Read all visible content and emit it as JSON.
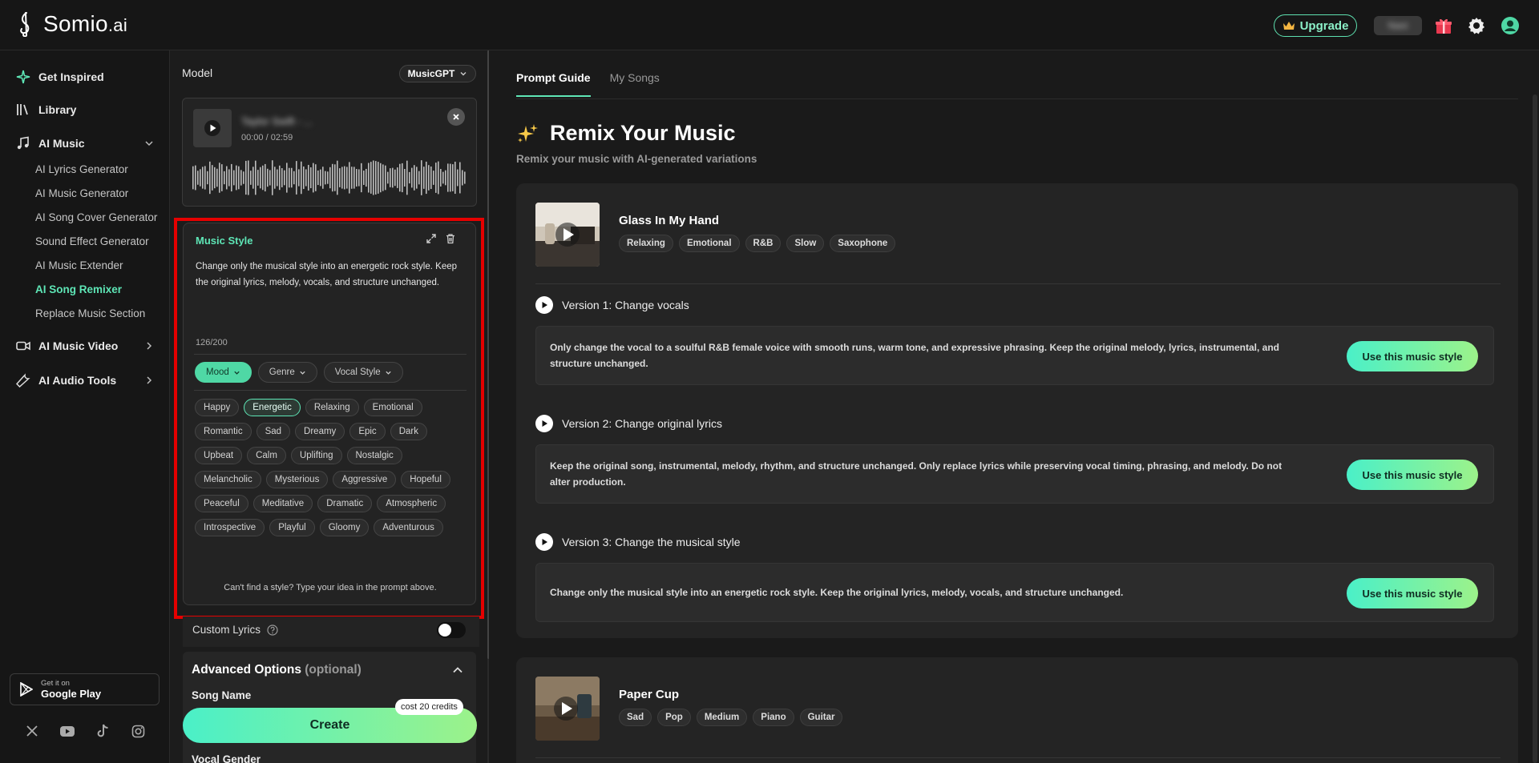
{
  "app": {
    "logo_main": "Somio",
    "logo_suffix": ".ai",
    "upgrade_label": "Upgrade",
    "user_label": "Nani"
  },
  "sidebar": {
    "get_inspired": "Get Inspired",
    "library": "Library",
    "ai_music": "AI Music",
    "sub_items": [
      "AI Lyrics Generator",
      "AI Music Generator",
      "AI Song Cover Generator",
      "Sound Effect Generator",
      "AI Music Extender",
      "AI Song Remixer",
      "Replace Music Section"
    ],
    "active_sub_index": 5,
    "ai_music_video": "AI Music Video",
    "ai_audio_tools": "AI Audio Tools",
    "gplay_small": "Get it on",
    "gplay_big": "Google Play"
  },
  "panel": {
    "model_label": "Model",
    "model_value": "MusicGPT",
    "player": {
      "title": "Taylor Swift - ...",
      "time": "00:00 / 02:59"
    },
    "style": {
      "title": "Music Style",
      "text": "Change only the musical style into an energetic rock style. Keep the original lyrics, melody, vocals, and structure unchanged.",
      "counter": "126/200",
      "filters": [
        "Mood",
        "Genre",
        "Vocal Style"
      ],
      "active_filter": "Mood",
      "chips": [
        "Happy",
        "Energetic",
        "Relaxing",
        "Emotional",
        "Romantic",
        "Sad",
        "Dreamy",
        "Epic",
        "Dark",
        "Upbeat",
        "Calm",
        "Uplifting",
        "Nostalgic",
        "Melancholic",
        "Mysterious",
        "Aggressive",
        "Hopeful",
        "Peaceful",
        "Meditative",
        "Dramatic",
        "Atmospheric",
        "Introspective",
        "Playful",
        "Gloomy",
        "Adventurous"
      ],
      "active_chip": "Energetic",
      "footer": "Can't find a style? Type your idea in the prompt above."
    },
    "custom_lyrics": "Custom Lyrics",
    "advanced_title": "Advanced Options",
    "advanced_optional": "(optional)",
    "song_name_label": "Song Name",
    "vocal_gender_label": "Vocal Gender",
    "create_label": "Create",
    "cost_label": "cost 20 credits"
  },
  "main": {
    "tabs": [
      "Prompt Guide",
      "My Songs"
    ],
    "active_tab": "Prompt Guide",
    "hero_title": "Remix Your Music",
    "hero_sub": "Remix your music with AI-generated variations",
    "cards": [
      {
        "song": "Glass In My Hand",
        "tags": [
          "Relaxing",
          "Emotional",
          "R&B",
          "Slow",
          "Saxophone"
        ],
        "versions": [
          {
            "title": "Version 1: Change vocals",
            "text": "Only change the vocal to a soulful R&B female voice with smooth runs, warm tone, and expressive phrasing. Keep the original melody, lyrics, instrumental, and structure unchanged.",
            "button": "Use this music style"
          },
          {
            "title": "Version 2: Change original lyrics",
            "text": "Keep the original song, instrumental, melody, rhythm, and structure unchanged. Only replace lyrics while preserving vocal timing, phrasing, and melody. Do not alter production.",
            "button": "Use this music style"
          },
          {
            "title": "Version 3: Change the musical style",
            "text": "Change only the musical style into an energetic rock style. Keep the original lyrics, melody, vocals, and structure unchanged.",
            "button": "Use this music style"
          }
        ]
      },
      {
        "song": "Paper Cup",
        "tags": [
          "Sad",
          "Pop",
          "Medium",
          "Piano",
          "Guitar"
        ],
        "versions": []
      }
    ]
  },
  "colors": {
    "accent": "#5ee6b6",
    "highlight": "#e60000",
    "button_gradient_start": "#4af0c8",
    "button_gradient_end": "#9cf28a"
  }
}
